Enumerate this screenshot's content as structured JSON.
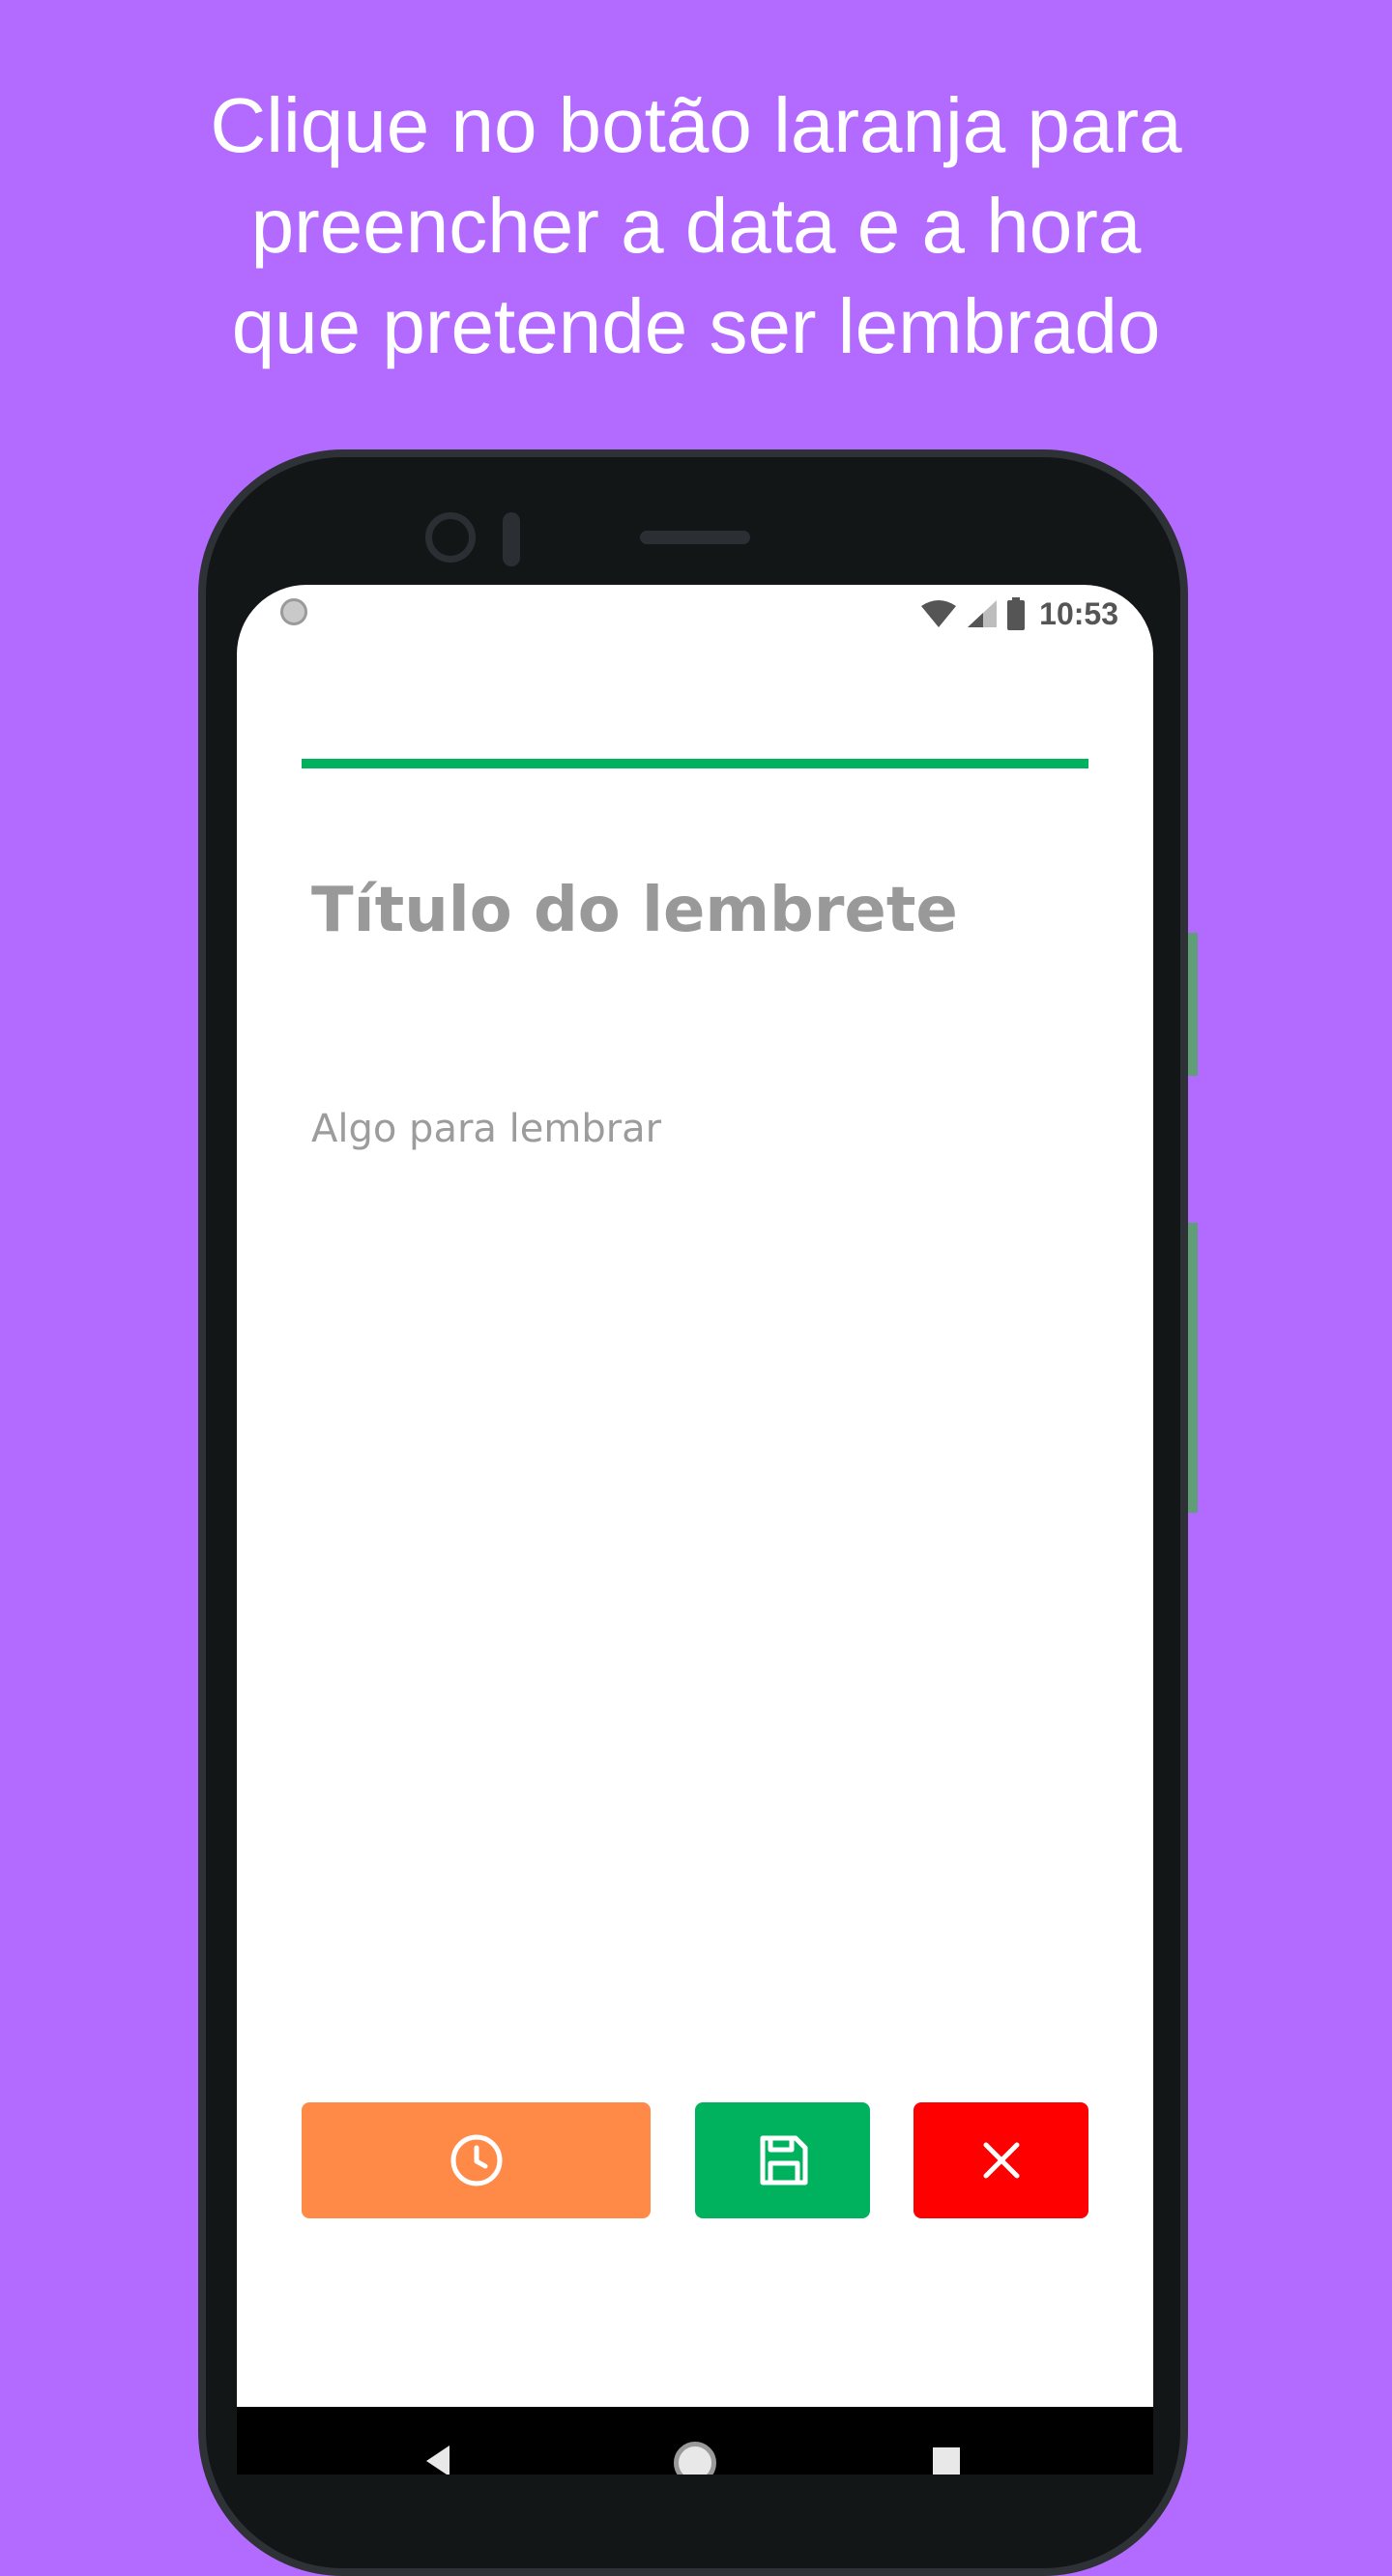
{
  "headline": {
    "line1": "Clique no botão laranja para",
    "line2": "preencher a data e a hora",
    "line3": "que pretende ser lembrado"
  },
  "status_bar": {
    "time": "10:53",
    "icons": [
      "wifi-icon",
      "signal-icon",
      "battery-icon"
    ]
  },
  "form": {
    "title_placeholder": "Título do lembrete",
    "title_value": "",
    "body_placeholder": "Algo para lembrar",
    "body_value": ""
  },
  "actions": {
    "datetime_icon": "clock-icon",
    "save_icon": "save-icon",
    "cancel_icon": "close-icon"
  },
  "colors": {
    "background": "#b36bff",
    "accent_green": "#00b25d",
    "datetime_button": "#ff8a48",
    "cancel_button": "#ff0000",
    "placeholder_text": "#999999"
  },
  "nav": {
    "icons": [
      "back-icon",
      "home-icon",
      "recents-icon"
    ]
  }
}
